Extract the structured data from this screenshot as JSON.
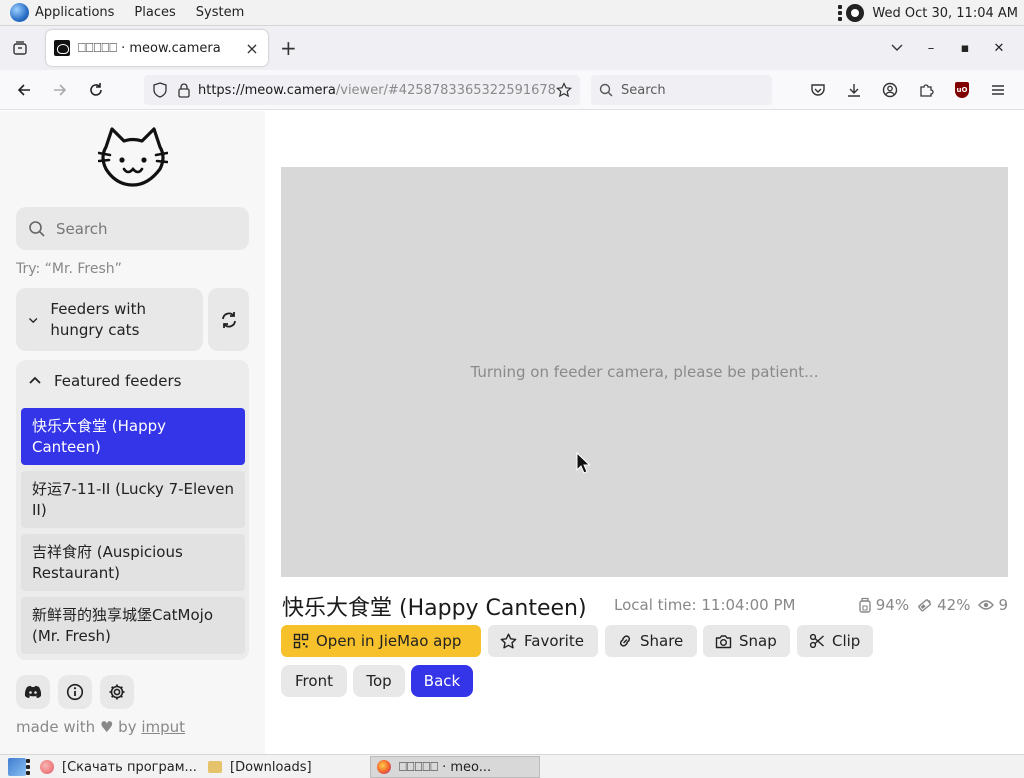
{
  "panel": {
    "menus": [
      "Applications",
      "Places",
      "System"
    ],
    "clock": "Wed Oct 30, 11:04 AM"
  },
  "browser": {
    "tab_title": "⚶⚶⚶⚶⚶ · meow.camera",
    "tab_title_display": "⎕⎕⎕⎕⎕ · meow.camera",
    "url_host": "https://meow.camera",
    "url_path": "/viewer/#4258783365322591678",
    "search_placeholder": "Search"
  },
  "sidebar": {
    "search_placeholder": "Search",
    "try_hint": "Try: “Mr. Fresh”",
    "hungry_group_label": "Feeders with hungry cats",
    "featured_label": "Featured feeders",
    "featured_items": [
      {
        "label": "快乐大食堂 (Happy Canteen)",
        "active": true
      },
      {
        "label": "好运7-11-II (Lucky 7-Eleven II)",
        "active": false
      },
      {
        "label": "吉祥食府 (Auspicious Restaurant)",
        "active": false
      },
      {
        "label": "新鲜哥的独享城堡CatMojo (Mr. Fresh)",
        "active": false
      }
    ],
    "made_with_prefix": "made with",
    "made_with_by": "by",
    "made_with_link": "imput"
  },
  "viewer": {
    "status_message": "Turning on feeder camera, please be patient..."
  },
  "feeder": {
    "title": "快乐大食堂 (Happy Canteen)",
    "local_time": "Local time: 11:04:00 PM",
    "food_level": "94%",
    "battery_level": "42%",
    "viewers": "9"
  },
  "actions": {
    "open_app": "Open in JieMao app",
    "favorite": "Favorite",
    "share": "Share",
    "snap": "Snap",
    "clip": "Clip"
  },
  "views": {
    "front": "Front",
    "top": "Top",
    "back": "Back",
    "selected": "Back"
  },
  "taskbar": {
    "items": [
      "[Скачать програм...",
      "[Downloads]",
      "⎕⎕⎕⎕⎕ · meo..."
    ]
  },
  "colors": {
    "accent_blue": "#3434e8",
    "primary_yellow": "#f7c12c",
    "viewer_bg": "#d8d8d8"
  }
}
